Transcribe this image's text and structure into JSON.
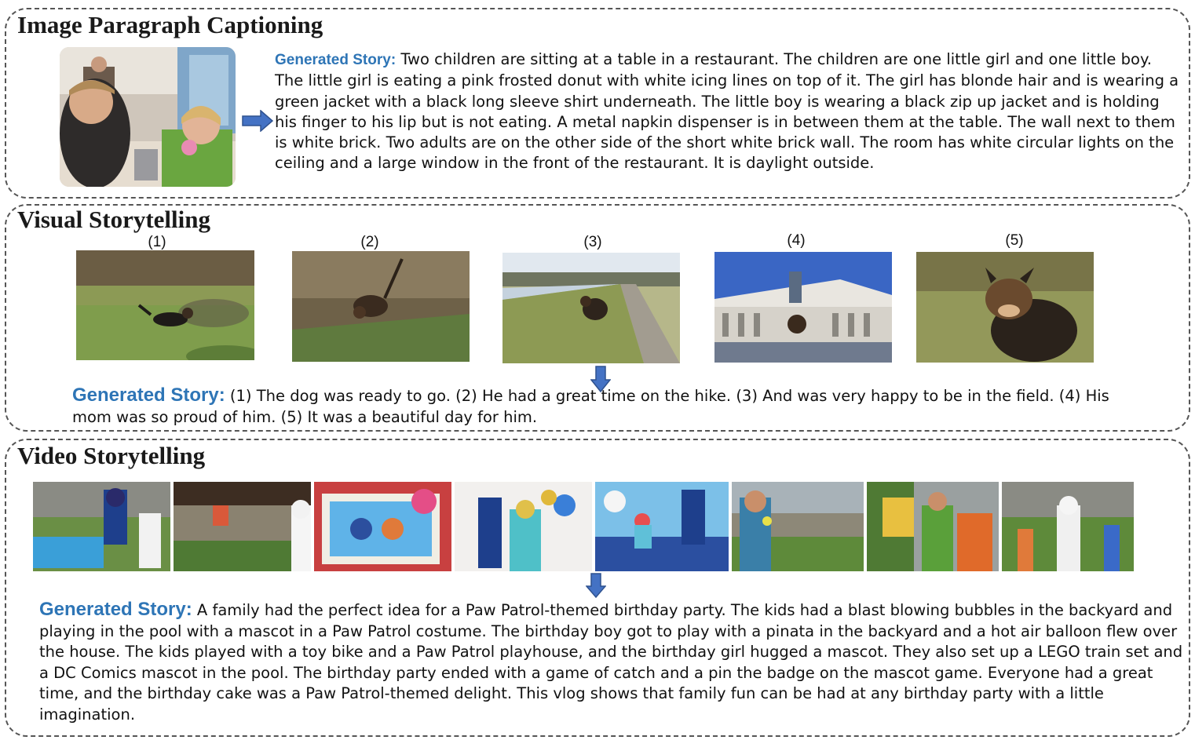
{
  "panels": [
    {
      "title": "Image Paragraph Captioning",
      "story_label": "Generated Story:",
      "story_text": "Two children are sitting at a table in a restaurant. The children are one little girl and one little boy. The little girl is eating a pink frosted donut with white icing lines on top of it. The girl has blonde hair and is wearing a green jacket with a black long sleeve shirt underneath. The little boy is wearing a black zip up jacket and is holding his finger to his lip but is not eating. A metal napkin dispenser is in between them at the table. The wall next to them is white brick. Two adults are on the other side of the short white brick wall. The room has white circular lights on the ceiling and a large window in the front of the restaurant. It is daylight outside."
    },
    {
      "title": "Visual Storytelling",
      "frame_labels": [
        "(1)",
        "(2)",
        "(3)",
        "(4)",
        "(5)"
      ],
      "story_label": "Generated Story:",
      "story_text": "(1) The dog was ready to go. (2) He had a great time on the hike. (3) And was very happy to be in the field. (4) His mom was so proud of him. (5) It was a beautiful day for him."
    },
    {
      "title": "Video Storytelling",
      "story_label": "Generated Story:",
      "story_text": "A family had the perfect idea for a Paw Patrol-themed birthday party. The kids had a blast blowing bubbles in the backyard and playing in the pool with a mascot in a Paw Patrol costume. The birthday boy got to play with a pinata in the backyard and a hot air balloon flew over the house. The kids played with a toy bike and a Paw Patrol playhouse, and the birthday girl hugged a mascot. They also set up a LEGO train set and a DC Comics mascot in the pool. The birthday party ended with a game of catch and a pin the badge on the mascot game. Everyone had a great time, and the birthday cake was a Paw Patrol-themed delight. This vlog shows that family fun can be had at any birthday party with a little imagination."
    }
  ],
  "colors": {
    "label_blue": "#2e75b6",
    "arrow_blue": "#4472c4",
    "border": "#555555"
  }
}
